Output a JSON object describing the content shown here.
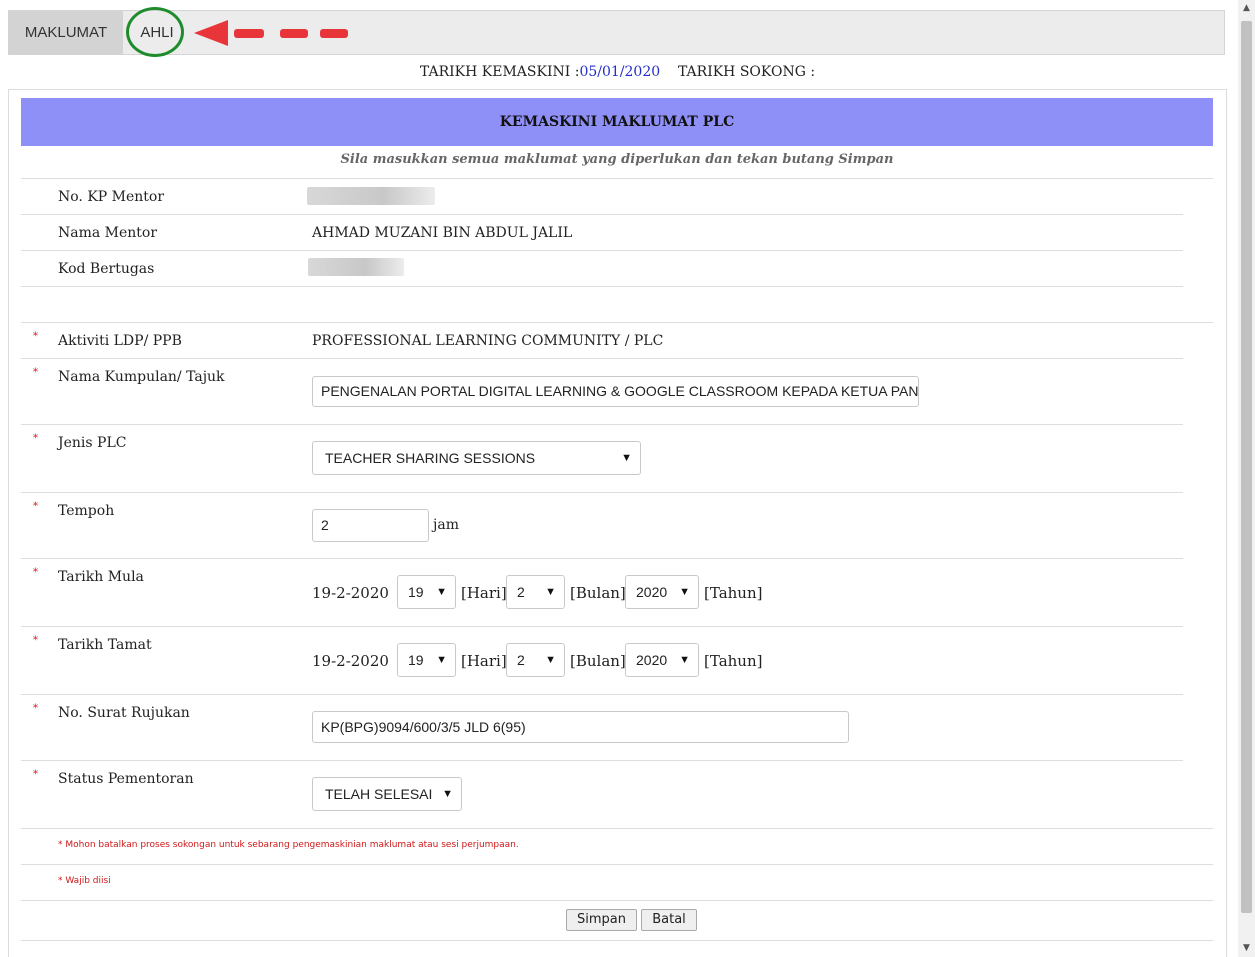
{
  "tabs": [
    {
      "label": "MAKLUMAT"
    },
    {
      "label": "AHLI"
    }
  ],
  "dates": {
    "updated_label": "TARIKH KEMASKINI :",
    "updated_value": "05/01/2020",
    "support_label": "TARIKH SOKONG :"
  },
  "form": {
    "header": "KEMASKINI MAKLUMAT PLC",
    "instruction": "Sila masukkan semua maklumat yang diperlukan dan tekan butang Simpan",
    "mentor_ic_label": "No. KP Mentor",
    "mentor_name_label": "Nama Mentor",
    "mentor_name_value": "AHMAD MUZANI BIN ABDUL JALIL",
    "duty_code_label": "Kod Bertugas",
    "activity_label": "Aktiviti LDP/ PPB",
    "activity_value": "PROFESSIONAL LEARNING COMMUNITY / PLC",
    "group_label": "Nama Kumpulan/ Tajuk",
    "group_value": "PENGENALAN PORTAL DIGITAL LEARNING & GOOGLE CLASSROOM KEPADA KETUA PANITIA",
    "plc_type_label": "Jenis PLC",
    "plc_type_value": "TEACHER SHARING SESSIONS",
    "duration_label": "Tempoh",
    "duration_value": "2",
    "duration_unit": "jam",
    "start_label": "Tarikh Mula",
    "start_date_text": "19-2-2020",
    "start_day": "19",
    "start_month": "2",
    "start_year": "2020",
    "end_label": "Tarikh Tamat",
    "end_date_text": "19-2-2020",
    "end_day": "19",
    "end_month": "2",
    "end_year": "2020",
    "day_unit": "[Hari]",
    "month_unit": "[Bulan]",
    "year_unit": "[Tahun]",
    "ref_label": "No. Surat Rujukan",
    "ref_value": "KP(BPG)9094/600/3/5 JLD 6(95)",
    "status_label": "Status Pementoran",
    "status_value": "TELAH SELESAI",
    "required_star": "*",
    "note_cancel": "* Mohon batalkan proses sokongan untuk sebarang pengemaskinian maklumat atau sesi perjumpaan.",
    "note_required": "* Wajib diisi",
    "save_label": "Simpan",
    "cancel_label": "Batal"
  },
  "icons": {
    "caret": "▼",
    "scroll_up": "▲",
    "scroll_down": "▼"
  },
  "colors": {
    "header_band": "#8f8ff8",
    "required": "#d01818",
    "date_value": "#2430c8",
    "annotation_circle": "#1f8c2c",
    "annotation_arrow": "#e8353a"
  }
}
